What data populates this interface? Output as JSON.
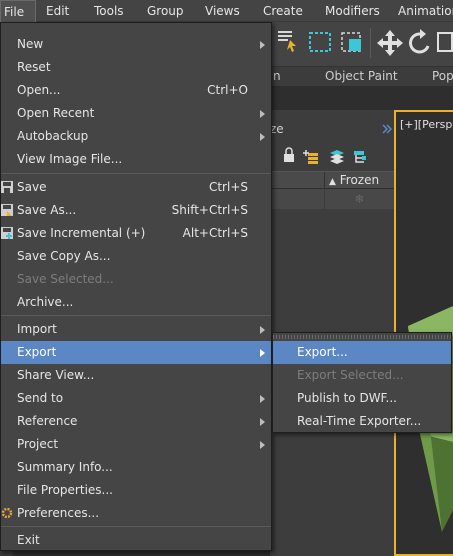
{
  "menubar": {
    "items": [
      "File",
      "Edit",
      "Tools",
      "Group",
      "Views",
      "Create",
      "Modifiers",
      "Animation"
    ]
  },
  "ribbon": {
    "left_fragment": "n",
    "object_paint": "Object Paint",
    "right_fragment": "Pop"
  },
  "scene_explorer": {
    "title_fragment": "ze",
    "column_header": "Frozen",
    "sort_glyph": "▲",
    "snowflake": "❄"
  },
  "viewport": {
    "label": "[+][Persp"
  },
  "file_menu": {
    "items": [
      {
        "label": "New",
        "shortcut": "",
        "submenu": true,
        "disabled": false
      },
      {
        "label": "Reset",
        "shortcut": "",
        "submenu": false,
        "disabled": false
      },
      {
        "label": "Open...",
        "shortcut": "Ctrl+O",
        "submenu": false,
        "disabled": false
      },
      {
        "label": "Open Recent",
        "shortcut": "",
        "submenu": true,
        "disabled": false
      },
      {
        "label": "Autobackup",
        "shortcut": "",
        "submenu": true,
        "disabled": false
      },
      {
        "label": "View Image File...",
        "shortcut": "",
        "submenu": false,
        "disabled": false
      },
      {
        "label": "Save",
        "shortcut": "Ctrl+S",
        "submenu": false,
        "disabled": false
      },
      {
        "label": "Save As...",
        "shortcut": "Shift+Ctrl+S",
        "submenu": false,
        "disabled": false
      },
      {
        "label": "Save Incremental (+)",
        "shortcut": "Alt+Ctrl+S",
        "submenu": false,
        "disabled": false
      },
      {
        "label": "Save Copy As...",
        "shortcut": "",
        "submenu": false,
        "disabled": false
      },
      {
        "label": "Save Selected...",
        "shortcut": "",
        "submenu": false,
        "disabled": true
      },
      {
        "label": "Archive...",
        "shortcut": "",
        "submenu": false,
        "disabled": false
      },
      {
        "label": "Import",
        "shortcut": "",
        "submenu": true,
        "disabled": false
      },
      {
        "label": "Export",
        "shortcut": "",
        "submenu": true,
        "disabled": false,
        "highlighted": true
      },
      {
        "label": "Share View...",
        "shortcut": "",
        "submenu": false,
        "disabled": false
      },
      {
        "label": "Send to",
        "shortcut": "",
        "submenu": true,
        "disabled": false
      },
      {
        "label": "Reference",
        "shortcut": "",
        "submenu": true,
        "disabled": false
      },
      {
        "label": "Project",
        "shortcut": "",
        "submenu": true,
        "disabled": false
      },
      {
        "label": "Summary Info...",
        "shortcut": "",
        "submenu": false,
        "disabled": false
      },
      {
        "label": "File Properties...",
        "shortcut": "",
        "submenu": false,
        "disabled": false
      },
      {
        "label": "Preferences...",
        "shortcut": "",
        "submenu": false,
        "disabled": false
      },
      {
        "label": "Exit",
        "shortcut": "",
        "submenu": false,
        "disabled": false
      }
    ]
  },
  "export_menu": {
    "items": [
      {
        "label": "Export...",
        "disabled": false,
        "highlighted": true
      },
      {
        "label": "Export Selected...",
        "disabled": true
      },
      {
        "label": "Publish to DWF...",
        "disabled": false
      },
      {
        "label": "Real-Time Exporter...",
        "disabled": false
      }
    ]
  },
  "colors": {
    "menu_bg": "#454545",
    "highlight": "#5b87c4",
    "accent_teal": "#3dc6d6",
    "viewport_border": "#e8b22d",
    "green_object": "#6f9a4a"
  }
}
